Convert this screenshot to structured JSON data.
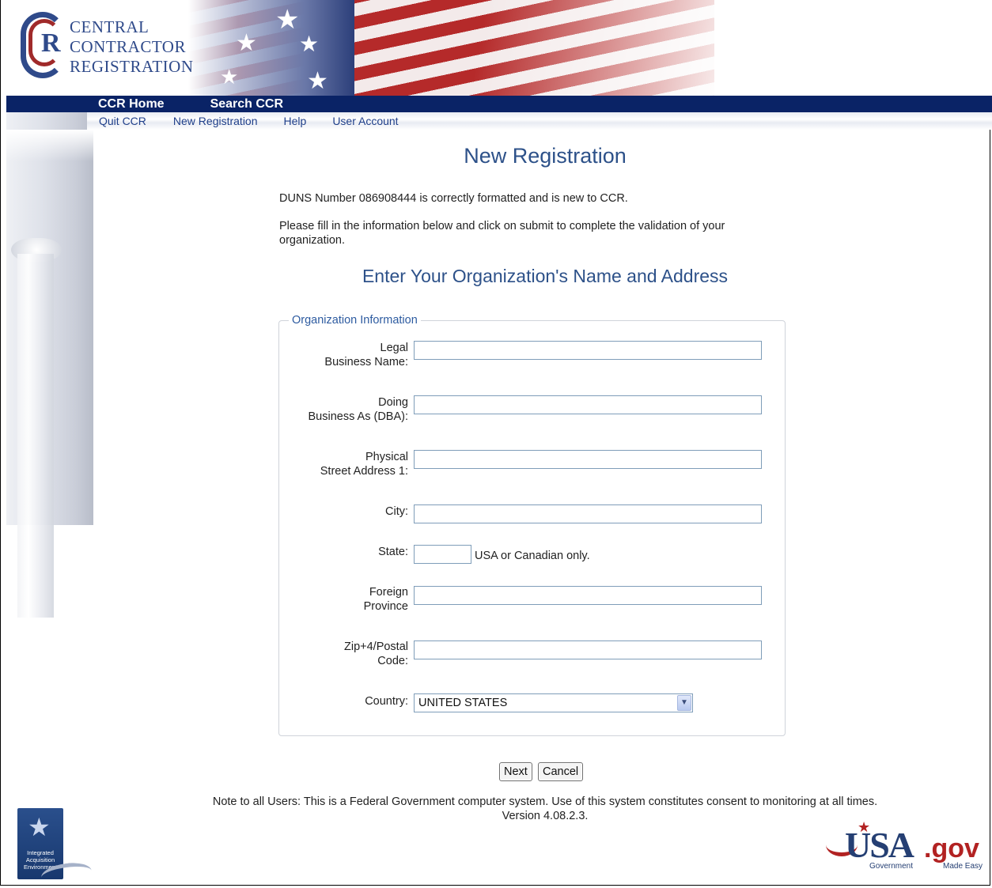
{
  "header": {
    "logo_lines": [
      "CENTRAL",
      "CONTRACTOR",
      "REGISTRATION"
    ],
    "logo_letter": "R",
    "main_nav": [
      "CCR Home",
      "Search CCR"
    ],
    "sub_nav": [
      "Quit CCR",
      "New Registration",
      "Help",
      "User Account"
    ]
  },
  "main": {
    "title": "New Registration",
    "duns_message": "DUNS Number 086908444 is correctly formatted and is new to CCR.",
    "instructions": "Please fill in the information below and click on submit to complete the validation of your organization.",
    "section_title": "Enter Your Organization's Name and Address",
    "legend": "Organization Information",
    "fields": {
      "legal_name_l1": "Legal",
      "legal_name_l2": "Business Name:",
      "dba_l1": "Doing",
      "dba_l2": "Business As (DBA):",
      "street_l1": "Physical",
      "street_l2": "Street Address 1:",
      "city": "City:",
      "state": "State:",
      "state_note": "USA or Canadian only.",
      "province_l1": "Foreign",
      "province_l2": "Province",
      "zip_l1": "Zip+4/Postal",
      "zip_l2": "Code:",
      "country": "Country:",
      "country_value": "UNITED STATES"
    },
    "buttons": {
      "next": "Next",
      "cancel": "Cancel"
    },
    "note_line1": "Note to all Users: This is a Federal Government computer system. Use of this system constitutes consent to monitoring at all times.",
    "note_line2": "Version 4.08.2.3."
  },
  "footer": {
    "iae_text": "Integrated Acquisition Environment",
    "usagov_usa": "USA",
    "usagov_gov": ".gov",
    "usagov_tag1": "Government",
    "usagov_tag2": "Made Easy"
  }
}
